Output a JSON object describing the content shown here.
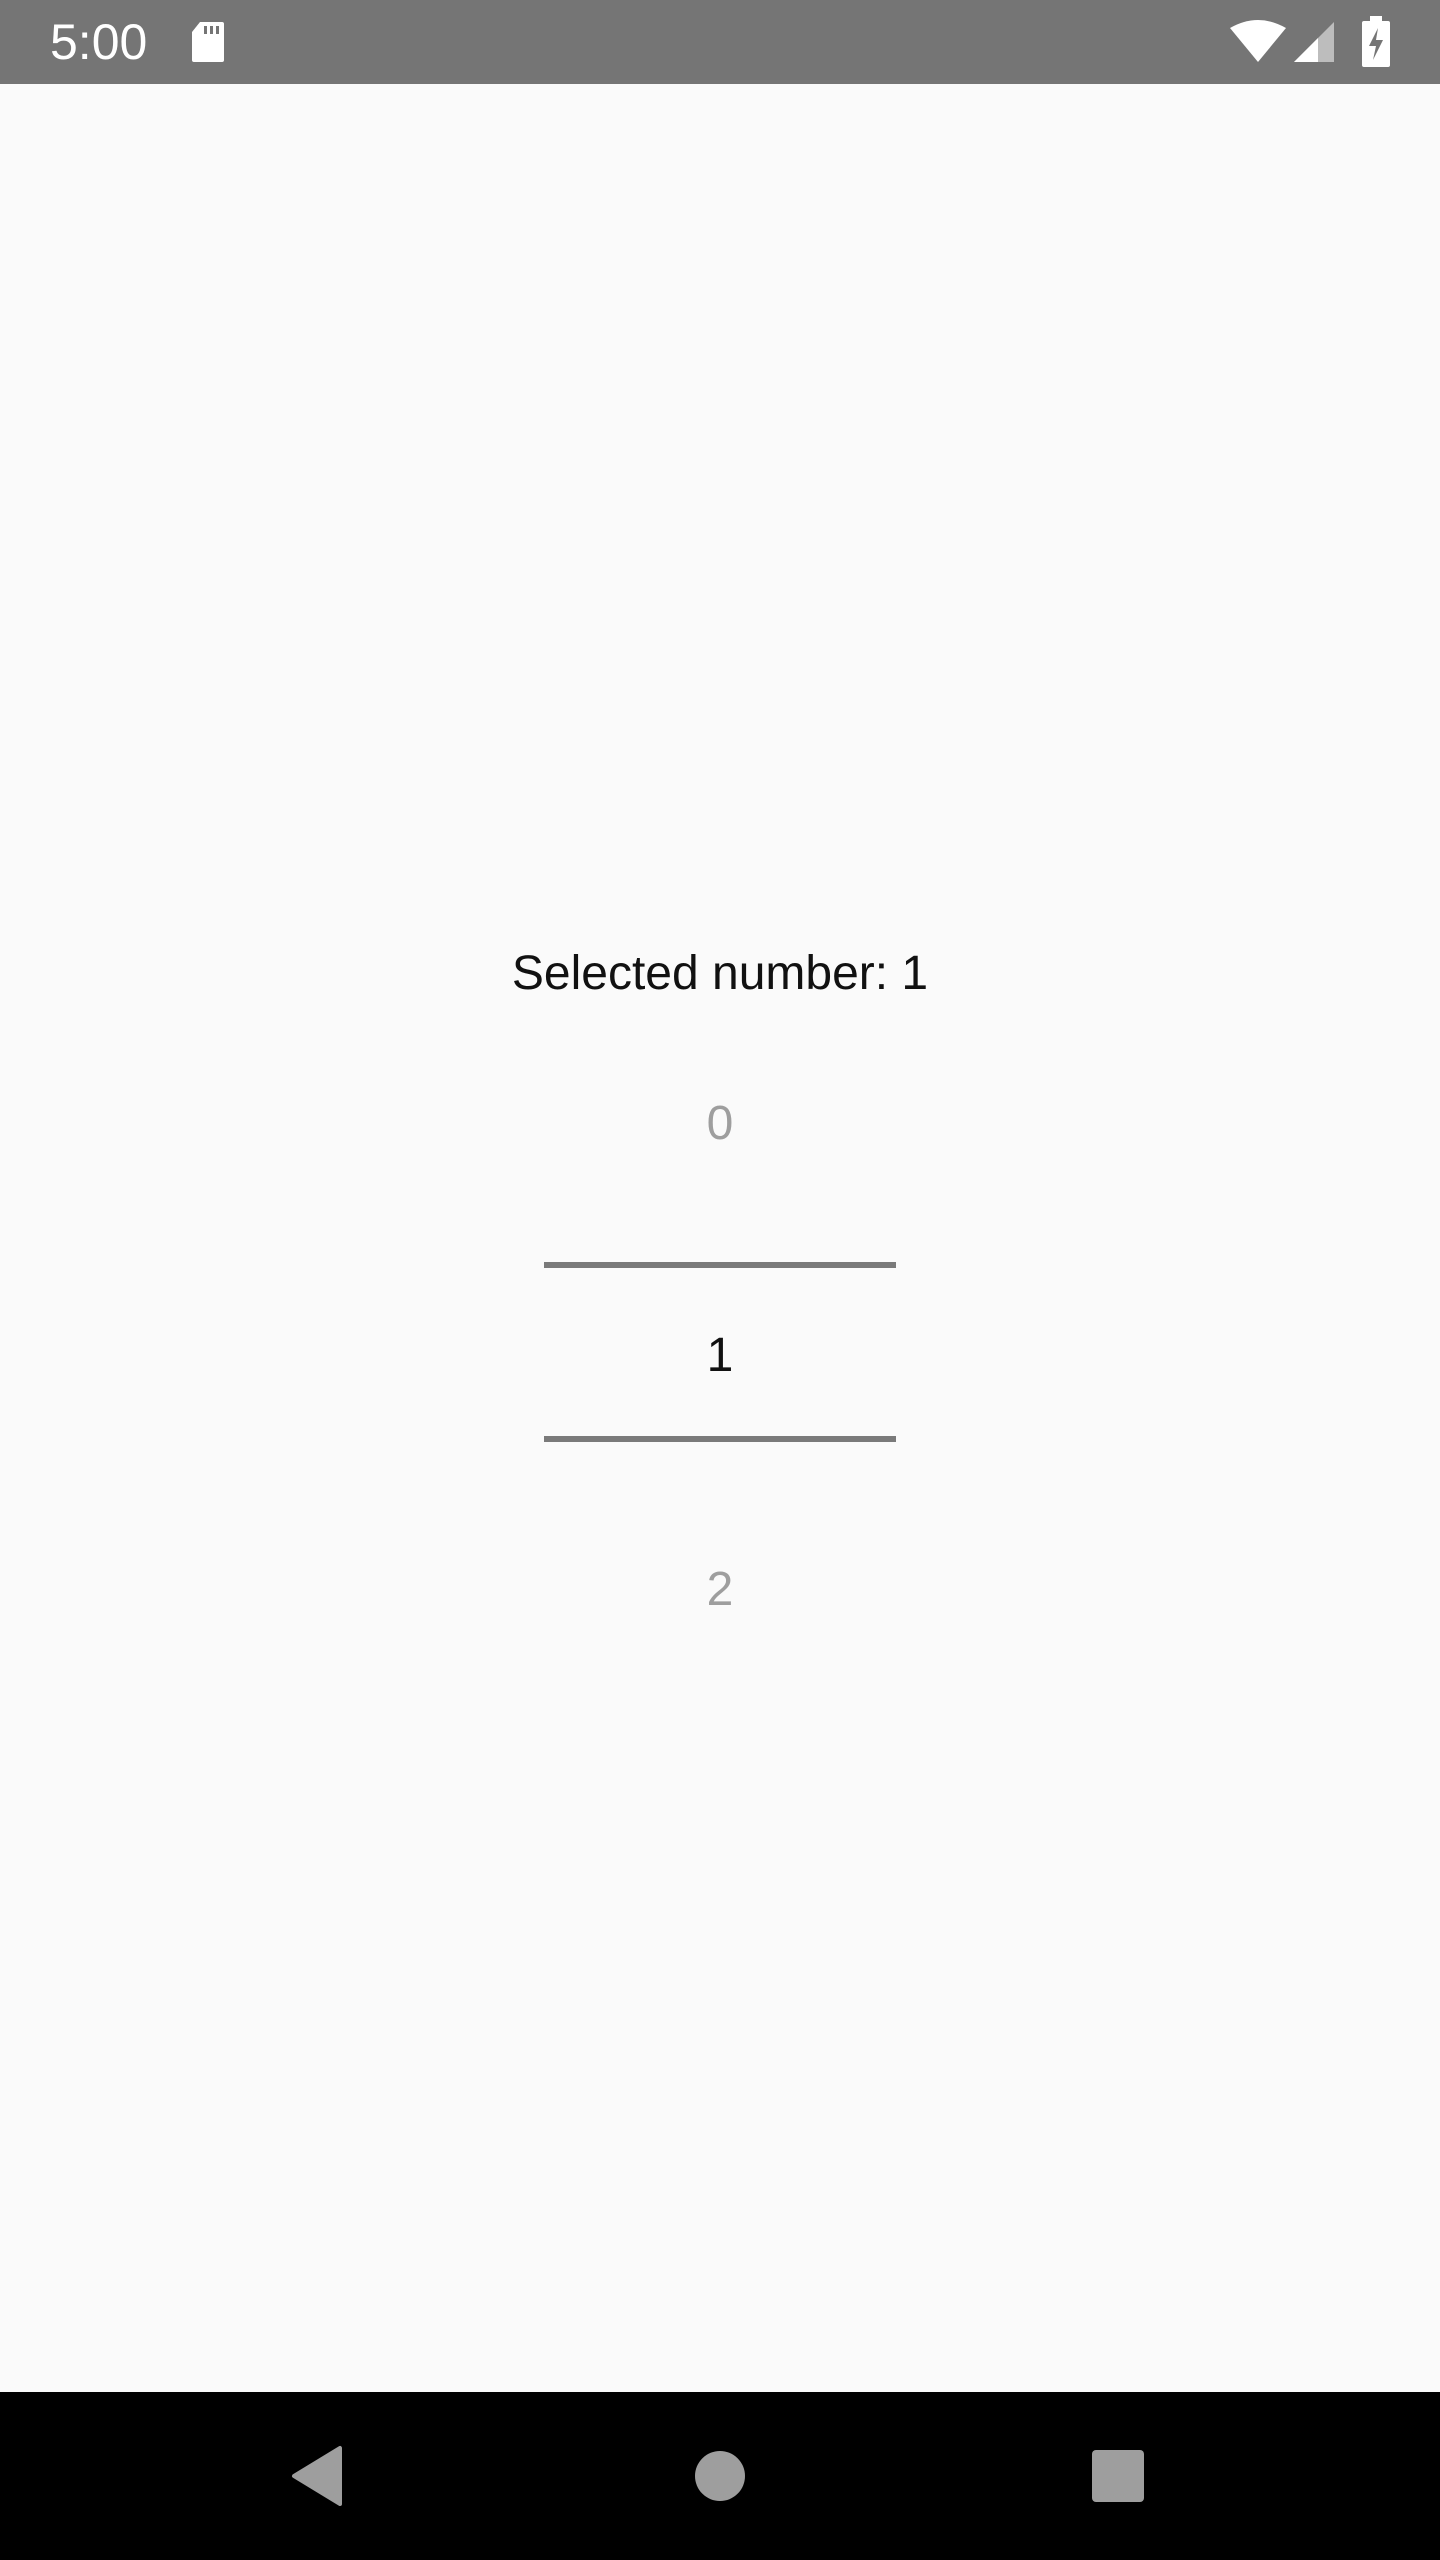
{
  "status_bar": {
    "time": "5:00",
    "icons": [
      "sd-card-icon",
      "wifi-icon",
      "cell-signal-icon",
      "battery-charging-icon"
    ]
  },
  "main": {
    "selected_label": "Selected number: 1",
    "picker": {
      "items": [
        "0",
        "1",
        "2"
      ],
      "selected": "1"
    }
  },
  "nav_bar": {
    "buttons": [
      "back-icon",
      "home-icon",
      "recents-icon"
    ]
  },
  "colors": {
    "status_bar": "#757575",
    "background": "#fafafa",
    "divider": "#7a7a7a",
    "dim_text": "#9e9e9e",
    "nav_bar": "#000000"
  }
}
